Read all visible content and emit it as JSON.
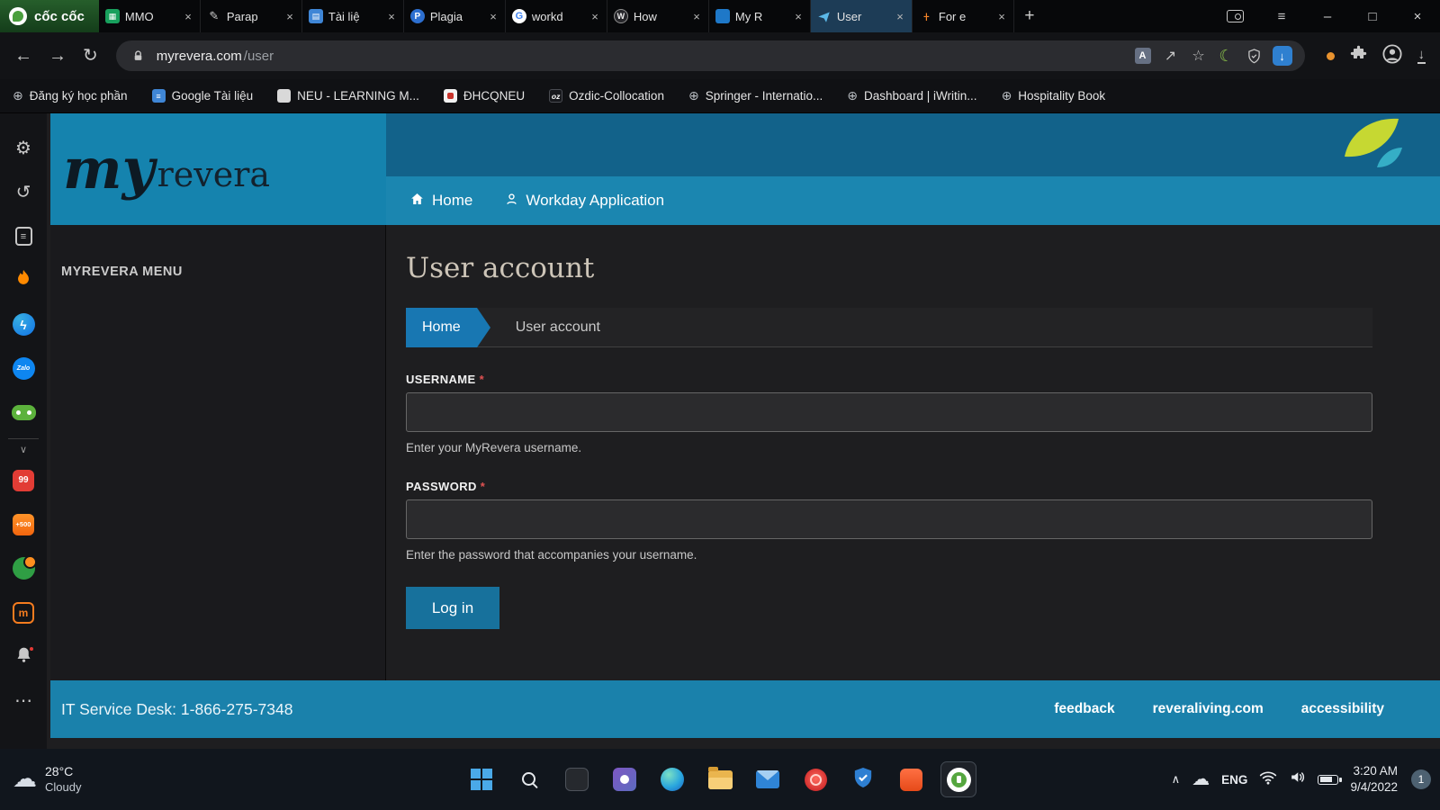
{
  "icons": {
    "back": "←",
    "forward": "→",
    "reload": "↻",
    "new_tab": "+",
    "close_tab": "×",
    "minimize": "–",
    "maximize": "□",
    "close": "×",
    "translate": "A",
    "share": "↗",
    "star": "☆",
    "moon": "☾",
    "down": "↓",
    "globe": "⊕",
    "gear": "⚙",
    "history": "↺",
    "list": "≡",
    "more": "⋯",
    "chev_up": "∧",
    "chev_down": "∨",
    "cloud": "☁",
    "bolt": "ϟ",
    "pencil": "✎",
    "grid": "▦",
    "doc": "▤",
    "letter_p": "P",
    "letter_g": "G",
    "letter_w": "W",
    "dash": "-|-",
    "oz": "oz",
    "zalo": "Zalo",
    "badge_99": "99",
    "badge_500": "+500",
    "letter_m": "m"
  },
  "chrome": {
    "brand": "cốc cốc",
    "tabs": [
      {
        "title": "MMO"
      },
      {
        "title": "Parap"
      },
      {
        "title": "Tài liệ"
      },
      {
        "title": "Plagia"
      },
      {
        "title": "workd"
      },
      {
        "title": "How"
      },
      {
        "title": "My R"
      },
      {
        "title": "User"
      },
      {
        "title": "For e"
      }
    ],
    "address": {
      "host": "myrevera.com",
      "path": "/user"
    },
    "bookmarks": [
      {
        "label": "Đăng ký học phần"
      },
      {
        "label": "Google Tài liệu"
      },
      {
        "label": "NEU - LEARNING M..."
      },
      {
        "label": "ĐHCQNEU"
      },
      {
        "label": "Ozdic-Collocation"
      },
      {
        "label": "Springer - Internatio..."
      },
      {
        "label": "Dashboard | iWritin..."
      },
      {
        "label": "Hospitality Book"
      }
    ]
  },
  "page": {
    "logo": {
      "my": "my",
      "revera": "revera"
    },
    "nav": {
      "home": "Home",
      "workday": "Workday Application"
    },
    "menu_title": "MYREVERA MENU",
    "title": "User account",
    "tabs": {
      "home": "Home",
      "current": "User account"
    },
    "form": {
      "username_label": "USERNAME",
      "required": "*",
      "username_help": "Enter your MyRevera username.",
      "password_label": "PASSWORD",
      "password_help": "Enter the password that accompanies your username.",
      "login": "Log in"
    },
    "footer": {
      "service_desk": "IT Service Desk: 1-866-275-7348",
      "links": [
        "feedback",
        "reveraliving.com",
        "accessibility"
      ]
    }
  },
  "taskbar": {
    "weather": {
      "temp": "28°C",
      "desc": "Cloudy"
    },
    "language": "ENG",
    "time": "3:20 AM",
    "date": "9/4/2022",
    "badge": "1"
  }
}
